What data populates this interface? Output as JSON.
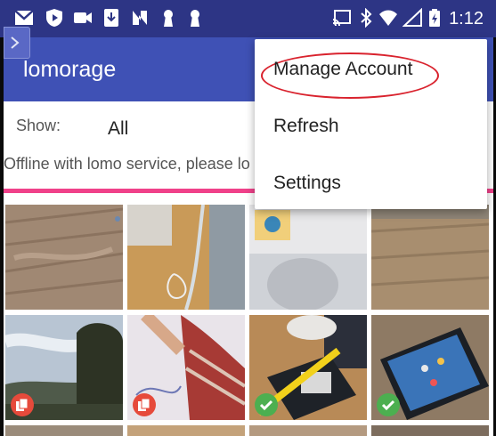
{
  "status_bar": {
    "time": "1:12",
    "icons": [
      "gmail-icon",
      "shield-play-icon",
      "video-camera-icon",
      "download-icon",
      "app-n-icon",
      "keyhole-icon",
      "keyhole-icon",
      "cast-icon",
      "bluetooth-icon",
      "wifi-icon",
      "signal-icon",
      "battery-charging-icon"
    ]
  },
  "app": {
    "title": "lomorage"
  },
  "filter": {
    "label": "Show:",
    "value": "All"
  },
  "offline_message": "Offline with lomo service, please lo",
  "menu": {
    "items": [
      "Manage Account",
      "Refresh",
      "Settings"
    ]
  },
  "photos": {
    "badges": [
      "none",
      "none",
      "none",
      "none",
      "red",
      "red",
      "green",
      "green"
    ]
  },
  "colors": {
    "status_bar": "#2d3585",
    "app_bar": "#3f51b5",
    "progress": "#f0418a",
    "annotation": "#d9232e"
  }
}
